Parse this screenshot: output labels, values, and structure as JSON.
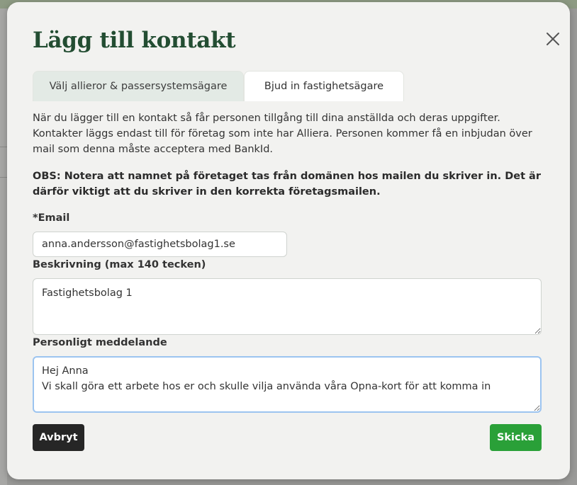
{
  "modal": {
    "title": "Lägg till kontakt"
  },
  "tabs": [
    {
      "label": "Välj allieror & passersystemsägare",
      "active": false
    },
    {
      "label": "Bjud in fastighetsägare",
      "active": true
    }
  ],
  "info": {
    "text": "När du lägger till en kontakt så får personen tillgång till dina anställda och deras uppgifter. Kontakter läggs endast till för företag som inte har Alliera. Personen kommer få en inbjudan över mail som denna måste acceptera med BankId.",
    "notice": "OBS: Notera att namnet på företaget tas från domänen hos mailen du skriver in. Det är därför viktigt att du skriver in den korrekta företagsmailen."
  },
  "form": {
    "email_label": "*Email",
    "email_value": "anna.andersson@fastighetsbolag1.se",
    "description_label": "Beskrivning (max 140 tecken)",
    "description_value": "Fastighetsbolag 1",
    "message_label": "Personligt meddelande",
    "message_value": "Hej Anna\nVi skall göra ett arbete hos er och skulle vilja använda våra Opna-kort för att komma in"
  },
  "buttons": {
    "cancel": "Avbryt",
    "submit": "Skicka"
  },
  "colors": {
    "title": "#234d32",
    "submit": "#2aa038",
    "cancel": "#262626",
    "focus_ring": "#9cc4f0"
  }
}
